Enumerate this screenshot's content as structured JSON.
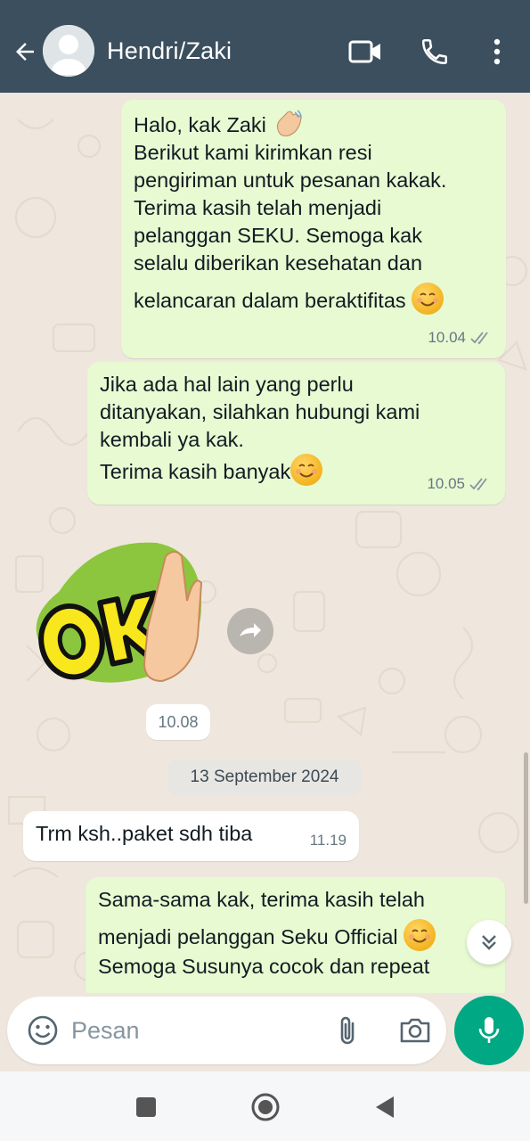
{
  "header": {
    "contact_name": "Hendri/Zaki",
    "icons": [
      "arrow-back-icon",
      "avatar",
      "video-call-icon",
      "phone-icon",
      "more-vert-icon"
    ]
  },
  "messages": [
    {
      "direction": "outgoing",
      "lines": [
        "Halo, kak Zaki",
        "Berikut kami kirimkan resi",
        "pengiriman untuk pesanan kakak.",
        "Terima kasih telah menjadi",
        "pelanggan SEKU. Semoga kak",
        "selalu diberikan kesehatan dan",
        "kelancaran dalam beraktifitas"
      ],
      "emojis": [
        "waving-hand-emoji",
        "smiling-face-emoji"
      ],
      "time": "10.04",
      "status": "delivered"
    },
    {
      "direction": "outgoing",
      "lines": [
        "Jika ada hal lain yang perlu",
        "ditanyakan, silahkan hubungi kami",
        "kembali ya kak.",
        "Terima kasih banyak"
      ],
      "emojis": [
        "smiling-face-emoji"
      ],
      "time": "10.05",
      "status": "delivered"
    },
    {
      "direction": "incoming",
      "type": "sticker",
      "sticker_text": "OK",
      "time": "10.08"
    },
    {
      "type": "date-separator",
      "text": "13 September 2024"
    },
    {
      "direction": "incoming",
      "lines": [
        "Trm ksh..paket sdh tiba"
      ],
      "time": "11.19"
    },
    {
      "direction": "outgoing",
      "lines": [
        "Sama-sama kak, terima kasih telah",
        "menjadi pelanggan Seku Official",
        "Semoga Susunya cocok dan repeat"
      ],
      "emojis": [
        "smiling-face-emoji"
      ]
    }
  ],
  "composer": {
    "placeholder": "Pesan",
    "value": ""
  },
  "colors": {
    "header_bg": "#3b4f5e",
    "outgoing_bubble": "#e7fad2",
    "incoming_bubble": "#ffffff",
    "chat_bg": "#efe7dd",
    "accent": "#00a884"
  }
}
